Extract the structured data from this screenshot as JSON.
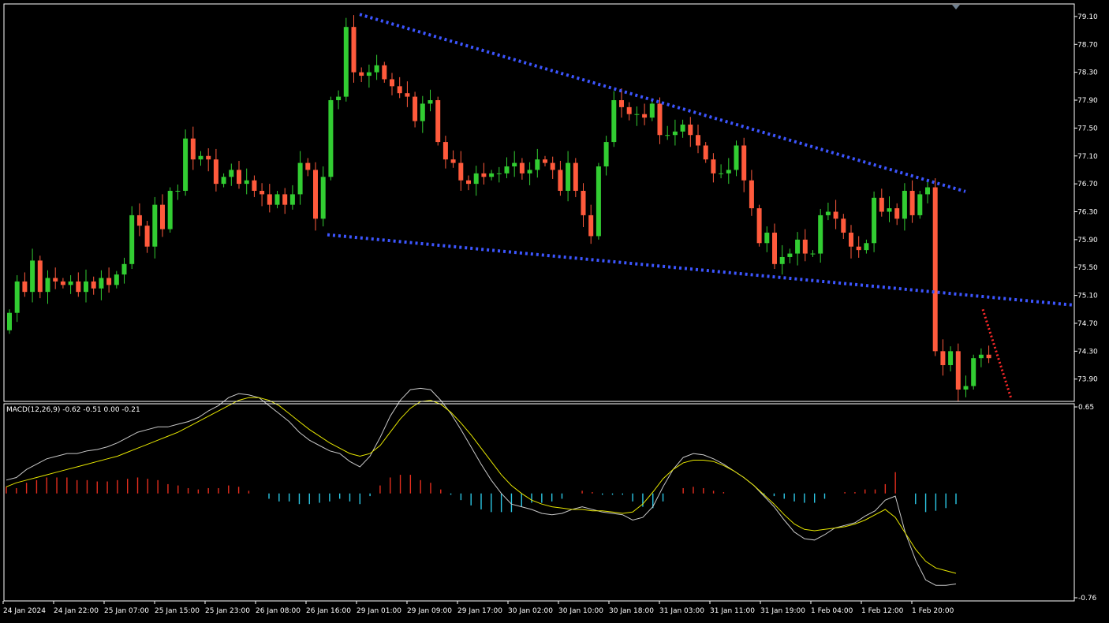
{
  "colors": {
    "background": "#000000",
    "frame": "#ffffff",
    "bull": "#32cd32",
    "bear": "#ff5a3c",
    "trendline": "#3c55ff",
    "projection": "#ff2a2a",
    "hist_pos": "#e62e1e",
    "hist_neg": "#2cc8e6",
    "macd_line": "#c8c8c8",
    "signal_line": "#e6e600"
  },
  "price_axis": {
    "ticks": [
      "79.10",
      "78.70",
      "78.30",
      "77.90",
      "77.50",
      "77.10",
      "76.70",
      "76.30",
      "75.90",
      "75.50",
      "75.10",
      "74.70",
      "74.30",
      "73.90"
    ]
  },
  "macd_panel": {
    "label": "MACD(12,26,9) -0.62 -0.51 0.00 -0.21",
    "ticks": [
      "0.65",
      "-0.76"
    ]
  },
  "time_axis": {
    "labels": [
      "24 Jan 2024",
      "24 Jan 22:00",
      "25 Jan 07:00",
      "25 Jan 15:00",
      "25 Jan 23:00",
      "26 Jan 08:00",
      "26 Jan 16:00",
      "29 Jan 01:00",
      "29 Jan 09:00",
      "29 Jan 17:00",
      "30 Jan 02:00",
      "30 Jan 10:00",
      "30 Jan 18:00",
      "31 Jan 03:00",
      "31 Jan 11:00",
      "31 Jan 19:00",
      "1 Feb 04:00",
      "1 Feb 12:00",
      "1 Feb 20:00"
    ]
  },
  "chart_data": [
    {
      "type": "candlestick",
      "title": "",
      "ylim": [
        73.58,
        79.28
      ],
      "grid": false,
      "closes": [
        74.85,
        75.3,
        75.15,
        75.6,
        75.15,
        75.35,
        75.3,
        75.25,
        75.3,
        75.15,
        75.3,
        75.2,
        75.35,
        75.25,
        75.4,
        75.55,
        76.25,
        76.1,
        75.8,
        76.4,
        76.05,
        76.6,
        76.6,
        77.35,
        77.05,
        77.1,
        77.05,
        76.7,
        76.8,
        76.9,
        76.7,
        76.75,
        76.6,
        76.55,
        76.4,
        76.55,
        76.4,
        76.55,
        77.0,
        76.9,
        76.2,
        76.8,
        77.9,
        77.95,
        78.95,
        78.3,
        78.25,
        78.3,
        78.4,
        78.2,
        78.1,
        78.0,
        77.95,
        77.6,
        77.85,
        77.9,
        77.3,
        77.05,
        77.0,
        76.75,
        76.7,
        76.85,
        76.8,
        76.85,
        76.85,
        76.95,
        77.0,
        76.85,
        76.9,
        77.05,
        77.0,
        76.9,
        76.6,
        77.0,
        76.6,
        76.25,
        75.95,
        76.95,
        77.3,
        77.9,
        77.8,
        77.7,
        77.7,
        77.65,
        77.85,
        77.4,
        77.4,
        77.45,
        77.55,
        77.4,
        77.25,
        77.05,
        76.85,
        76.85,
        76.9,
        77.25,
        76.75,
        76.35,
        75.85,
        76.0,
        75.55,
        75.65,
        75.7,
        75.9,
        75.7,
        75.7,
        76.25,
        76.3,
        76.2,
        76.0,
        75.8,
        75.75,
        75.85,
        76.5,
        76.3,
        76.35,
        76.2,
        76.6,
        76.25,
        76.55,
        76.65,
        74.3,
        74.1,
        74.3,
        73.75,
        73.8,
        74.2,
        74.25,
        74.2
      ],
      "last_price_start_hint": 74.1
    },
    {
      "type": "line",
      "title": "MACD(12,26,9)",
      "ylim": [
        -0.76,
        0.65
      ],
      "series": [
        {
          "name": "MACD(12,26,9)",
          "values": [
            0.1,
            0.12,
            0.18,
            0.22,
            0.26,
            0.28,
            0.3,
            0.3,
            0.32,
            0.33,
            0.35,
            0.38,
            0.42,
            0.46,
            0.48,
            0.5,
            0.5,
            0.52,
            0.54,
            0.57,
            0.62,
            0.66,
            0.72,
            0.75,
            0.74,
            0.72,
            0.66,
            0.6,
            0.54,
            0.46,
            0.4,
            0.36,
            0.32,
            0.3,
            0.24,
            0.2,
            0.28,
            0.42,
            0.58,
            0.7,
            0.78,
            0.79,
            0.78,
            0.7,
            0.6,
            0.48,
            0.35,
            0.22,
            0.1,
            0.0,
            -0.08,
            -0.1,
            -0.12,
            -0.15,
            -0.16,
            -0.15,
            -0.12,
            -0.1,
            -0.12,
            -0.14,
            -0.15,
            -0.16,
            -0.2,
            -0.18,
            -0.1,
            0.05,
            0.18,
            0.27,
            0.3,
            0.29,
            0.26,
            0.22,
            0.17,
            0.12,
            0.06,
            -0.02,
            -0.1,
            -0.2,
            -0.29,
            -0.34,
            -0.35,
            -0.31,
            -0.26,
            -0.24,
            -0.22,
            -0.17,
            -0.13,
            -0.05,
            -0.02,
            -0.3,
            -0.5,
            -0.65,
            -0.69,
            -0.69,
            -0.68
          ]
        },
        {
          "name": "Signal",
          "values": [
            0.05,
            0.08,
            0.1,
            0.12,
            0.14,
            0.16,
            0.18,
            0.2,
            0.22,
            0.24,
            0.26,
            0.28,
            0.31,
            0.34,
            0.37,
            0.4,
            0.43,
            0.46,
            0.5,
            0.54,
            0.58,
            0.62,
            0.66,
            0.7,
            0.72,
            0.72,
            0.7,
            0.66,
            0.6,
            0.54,
            0.48,
            0.43,
            0.38,
            0.34,
            0.3,
            0.28,
            0.3,
            0.36,
            0.46,
            0.56,
            0.64,
            0.69,
            0.7,
            0.67,
            0.61,
            0.53,
            0.44,
            0.34,
            0.24,
            0.14,
            0.06,
            0.0,
            -0.05,
            -0.08,
            -0.1,
            -0.11,
            -0.12,
            -0.12,
            -0.13,
            -0.13,
            -0.14,
            -0.15,
            -0.14,
            -0.08,
            0.01,
            0.11,
            0.18,
            0.23,
            0.25,
            0.25,
            0.24,
            0.21,
            0.17,
            0.12,
            0.06,
            -0.01,
            -0.08,
            -0.16,
            -0.23,
            -0.27,
            -0.28,
            -0.27,
            -0.26,
            -0.25,
            -0.23,
            -0.2,
            -0.16,
            -0.12,
            -0.18,
            -0.3,
            -0.42,
            -0.51,
            -0.56,
            -0.58,
            -0.6
          ]
        },
        {
          "name": "Histogram",
          "values": [
            0.05,
            0.04,
            0.08,
            0.1,
            0.12,
            0.12,
            0.12,
            0.1,
            0.1,
            0.09,
            0.09,
            0.1,
            0.11,
            0.12,
            0.11,
            0.1,
            0.07,
            0.06,
            0.04,
            0.03,
            0.04,
            0.04,
            0.06,
            0.05,
            0.02,
            0.0,
            -0.04,
            -0.06,
            -0.06,
            -0.08,
            -0.08,
            -0.07,
            -0.06,
            -0.04,
            -0.06,
            -0.08,
            -0.02,
            0.06,
            0.12,
            0.14,
            0.14,
            0.1,
            0.08,
            0.03,
            -0.01,
            -0.05,
            -0.09,
            -0.12,
            -0.14,
            -0.14,
            -0.14,
            -0.1,
            -0.07,
            -0.07,
            -0.06,
            -0.04,
            0.0,
            0.02,
            0.01,
            -0.01,
            -0.01,
            -0.01,
            -0.06,
            -0.1,
            -0.11,
            -0.06,
            0.0,
            0.04,
            0.05,
            0.04,
            0.02,
            0.01,
            0.0,
            0.0,
            0.0,
            -0.01,
            -0.02,
            -0.04,
            -0.06,
            -0.07,
            -0.07,
            -0.04,
            0.0,
            0.01,
            0.01,
            0.03,
            0.03,
            0.07,
            0.16,
            0.0,
            -0.08,
            -0.14,
            -0.13,
            -0.11,
            -0.08
          ]
        }
      ]
    }
  ]
}
